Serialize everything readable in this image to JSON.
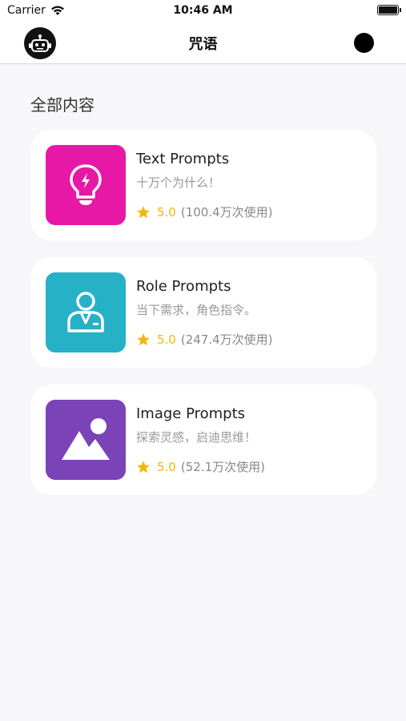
{
  "status_bar": {
    "carrier": "Carrier",
    "time": "10:46 AM"
  },
  "nav": {
    "title": "咒语"
  },
  "section": {
    "title": "全部内容"
  },
  "cards": [
    {
      "title": "Text Prompts",
      "subtitle": "十万个为什么！",
      "rating": "5.0",
      "usage": "(100.4万次使用)",
      "icon": "lightbulb-icon",
      "color": "#e718a6"
    },
    {
      "title": "Role Prompts",
      "subtitle": "当下需求，角色指令。",
      "rating": "5.0",
      "usage": "(247.4万次使用)",
      "icon": "person-icon",
      "color": "#26b1c6"
    },
    {
      "title": "Image Prompts",
      "subtitle": "探索灵感，启迪思维！",
      "rating": "5.0",
      "usage": "(52.1万次使用)",
      "icon": "image-icon",
      "color": "#7b43b8"
    }
  ],
  "colors": {
    "star": "#f2b705",
    "background": "#f7f7fa"
  }
}
